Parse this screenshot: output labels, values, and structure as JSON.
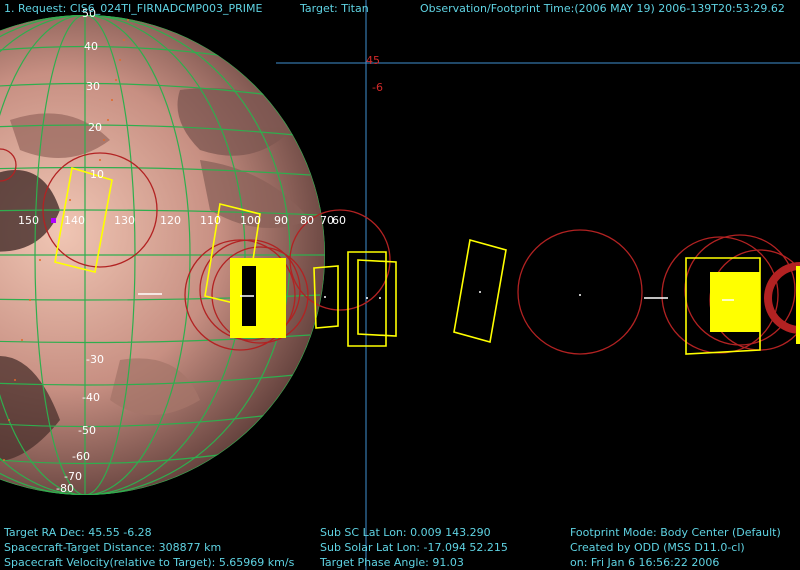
{
  "header": {
    "request": "1. Request: CIS6_024TI_FIRNADCMP003_PRIME",
    "target": "Target: Titan",
    "time": "Observation/Footprint Time:(2006 MAY 19) 2006-139T20:53:29.62"
  },
  "crosshair": {
    "lat_label": "45",
    "dec_label": "-6"
  },
  "grid": {
    "lat_labels": [
      "50",
      "40",
      "30",
      "20",
      "10",
      "-30",
      "-40",
      "-50",
      "-60",
      "-70",
      "-80"
    ],
    "lon_labels": [
      "150",
      "140",
      "130",
      "120",
      "110",
      "100",
      "90",
      "80",
      "70",
      "60"
    ]
  },
  "footer": {
    "col1": [
      "Target RA  Dec: 45.55   -6.28",
      "Spacecraft-Target Distance:   308877 km",
      "Spacecraft Velocity(relative to Target): 5.65969 km/s"
    ],
    "col2": [
      "Sub SC Lat Lon:  0.009  143.290",
      "Sub Solar Lat Lon: -17.094  52.215",
      "Target Phase Angle: 91.03"
    ],
    "col3": [
      "Footprint Mode: Body Center (Default)",
      "Created by ODD (MSS D11.0-cl)",
      "on: Fri Jan  6 16:56:22 2006"
    ]
  },
  "colors": {
    "text": "#5fd3e3",
    "grid": "#2fae4e",
    "footprint_rect": "#ffff00",
    "footprint_circle": "#b22222",
    "crosshair": "#3f8fd0"
  }
}
